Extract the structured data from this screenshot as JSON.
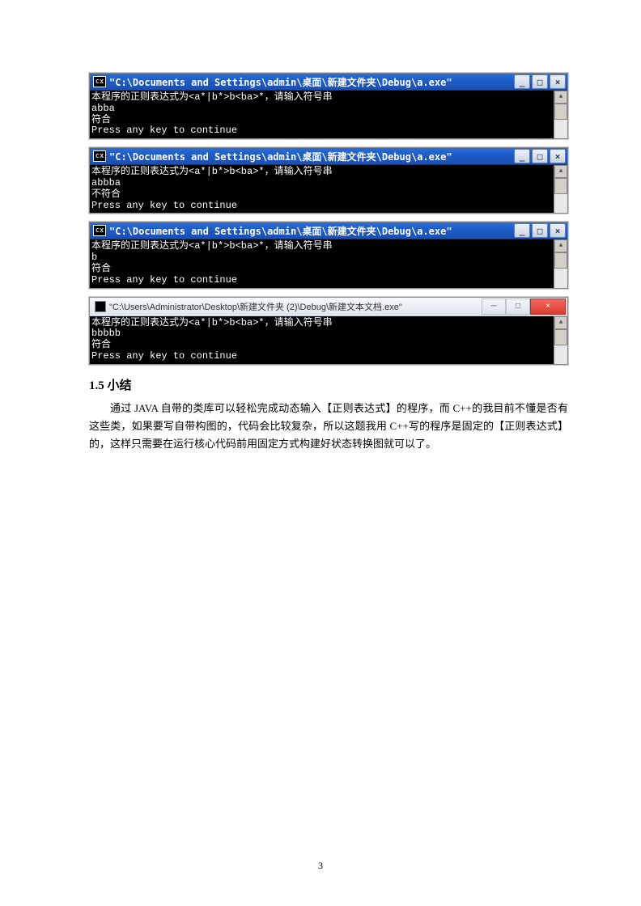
{
  "consoles": [
    {
      "style": "xp",
      "icon": "cx",
      "title": "\"C:\\Documents and Settings\\admin\\桌面\\新建文件夹\\Debug\\a.exe\"",
      "lines": [
        "本程序的正则表达式为<a*|b*>b<ba>*，请输入符号串",
        "abba",
        "符合",
        "Press any key to continue"
      ]
    },
    {
      "style": "xp",
      "icon": "cx",
      "title": "\"C:\\Documents and Settings\\admin\\桌面\\新建文件夹\\Debug\\a.exe\"",
      "lines": [
        "本程序的正则表达式为<a*|b*>b<ba>*，请输入符号串",
        "abbba",
        "不符合",
        "Press any key to continue"
      ]
    },
    {
      "style": "xp",
      "icon": "cx",
      "title": "\"C:\\Documents and Settings\\admin\\桌面\\新建文件夹\\Debug\\a.exe\"",
      "lines": [
        "本程序的正则表达式为<a*|b*>b<ba>*，请输入符号串",
        "b",
        "符合",
        "Press any key to continue"
      ]
    },
    {
      "style": "win7",
      "icon": "",
      "title": "\"C:\\Users\\Administrator\\Desktop\\新建文件夹 (2)\\Debug\\新建文本文档.exe\"",
      "lines": [
        "本程序的正则表达式为<a*|b*>b<ba>*，请输入符号串",
        "bbbbb",
        "符合",
        "Press any key to continue"
      ]
    }
  ],
  "section": {
    "heading": "1.5  小结",
    "paragraph": "通过 JAVA 自带的类库可以轻松完成动态输入【正则表达式】的程序，而 C++的我目前不懂是否有这些类，如果要写自带构图的，代码会比较复杂，所以这题我用 C++写的程序是固定的【正则表达式】的，这样只需要在运行核心代码前用固定方式构建好状态转换图就可以了。"
  },
  "buttons": {
    "min": "_",
    "max": "□",
    "close": "×",
    "min_w7": "─",
    "max_w7": "□",
    "close_w7": "×"
  },
  "pageNumber": "3"
}
